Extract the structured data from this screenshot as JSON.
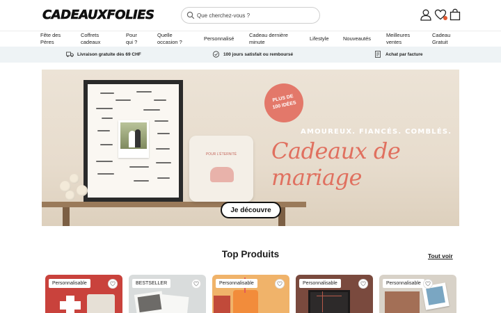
{
  "header": {
    "logo": "CADEAUXFOLIES",
    "search_placeholder": "Que cherchez-vous ?"
  },
  "nav": [
    {
      "line1": "Fête des",
      "line2": "Pères"
    },
    {
      "line1": "Coffrets",
      "line2": "cadeaux"
    },
    {
      "line1": "Pour",
      "line2": "qui ?"
    },
    {
      "line1": "Quelle",
      "line2": "occasion ?"
    },
    {
      "line1": "Personnalisé",
      "line2": ""
    },
    {
      "line1": "Cadeau dernière",
      "line2": "minute"
    },
    {
      "line1": "Lifestyle",
      "line2": ""
    },
    {
      "line1": "Nouveautés",
      "line2": ""
    },
    {
      "line1": "Meilleures",
      "line2": "ventes"
    },
    {
      "line1": "Cadeau",
      "line2": "Gratuit"
    }
  ],
  "benefits": [
    {
      "icon": "truck-icon",
      "text": "Livraison gratuite dès 69 CHF"
    },
    {
      "icon": "satisfaction-icon",
      "text": "100 jours satisfait ou remboursé"
    },
    {
      "icon": "invoice-icon",
      "text": "Achat par facture"
    }
  ],
  "hero": {
    "badge_line1": "PLUS DE",
    "badge_line2": "100 IDÉES",
    "subtitle": "AMOUREUX. FIANCÉS. COMBLÉS.",
    "title": "Cadeaux de mariage",
    "pillow_text": "POUR L'ÉTERNITÉ",
    "cta": "Je découvre"
  },
  "products": {
    "title": "Top Produits",
    "see_all": "Tout voir",
    "items": [
      {
        "tag": "Personnalisable",
        "color": "#c9423c"
      },
      {
        "tag": "BESTSELLER",
        "color": "#d9dcdc"
      },
      {
        "tag": "Personnalisable",
        "color": "#f0b36a"
      },
      {
        "tag": "Personnalisable",
        "color": "#7a4a3e"
      },
      {
        "tag": "Personnalisable",
        "color": "#d8d2c8"
      }
    ]
  },
  "colors": {
    "accent": "#e0705f",
    "benefits_bg": "#eef3f5"
  }
}
